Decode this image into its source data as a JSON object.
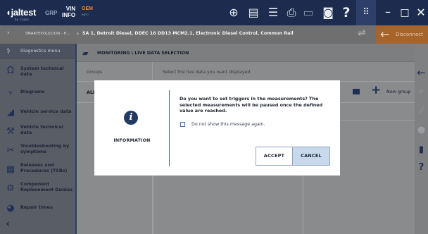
{
  "topbar": {
    "logo": "jaltest",
    "logo_sub": "by Cojali",
    "grp": "GRP",
    "vin_line1": "VIN",
    "vin_line2": "INFO",
    "oem_line1": "OEM",
    "oem_line2": "INFO",
    "icons": [
      "globe-icon",
      "document-icon",
      "list-icon",
      "print-icon",
      "battery-icon",
      "camera-icon",
      "help-icon",
      "grid-icon",
      "minimize-icon",
      "maximize-icon",
      "close-icon"
    ],
    "glyphs": {
      "globe": "⊕",
      "doc": "▤",
      "list": "☰",
      "print": "⎙",
      "battery": "▭",
      "camera": "◙",
      "help": "?",
      "grid": "⠿",
      "min": "–",
      "max": "□",
      "close": "✕"
    }
  },
  "breadcrumb": {
    "chevron": "›",
    "item1": "SMARTEVOLUCION - H...",
    "separator": "›",
    "item2": "SA 1, Detroit Diesel, DDEC 16 DD13 MCM2.1, Electronic Diesel Control, Common Rail",
    "disconnect_label": "Disconnect",
    "disconnect_arrow": "←",
    "plug_glyph": "⇌"
  },
  "sidebar": {
    "header_label": "Diagnostics menu",
    "header_icon": "stethoscope-icon",
    "items": [
      {
        "label": "System technical data",
        "icon": "omega-icon",
        "glyph": "Ω"
      },
      {
        "label": "Diagrams",
        "icon": "diagram-icon",
        "glyph": "⫟"
      },
      {
        "label": "Vehicle service data",
        "icon": "oil-can-icon",
        "glyph": "◢"
      },
      {
        "label": "Vehicle technical data",
        "icon": "wrench-icon",
        "glyph": "⚒"
      },
      {
        "label": "Troubleshooting by symptoms",
        "icon": "tools-icon",
        "glyph": "✂"
      },
      {
        "label": "Releases and Procedures (TSBs)",
        "icon": "book-icon",
        "glyph": "▦"
      },
      {
        "label": "Component Replacement Guides",
        "icon": "replace-icon",
        "glyph": "⚙"
      },
      {
        "label": "Repair times",
        "icon": "gear-clock-icon",
        "glyph": "◕"
      }
    ],
    "back_glyph": "‹"
  },
  "main": {
    "header_title": "MONITORING \\ LIVE DATA SELECTION",
    "groups_label": "Groups",
    "select_label": "Select the live data you want displayed",
    "all_label": "ALL",
    "new_group_label": "New group",
    "plus_glyph": "+"
  },
  "right_toolbar": {
    "icons": [
      "back-arrow-icon",
      "search-icon",
      "chart-icon",
      "record-icon",
      "save-icon",
      "help-icon"
    ],
    "glyphs": [
      "←",
      "⌕",
      "⟋",
      "●",
      "▮",
      "?"
    ]
  },
  "modal": {
    "title": "INFORMATION",
    "info_glyph": "i",
    "message": "Do you want to set triggers in the measurements? The selected measurements will be paused once the defined value are reached.",
    "checkbox_label": "Do not show this message again.",
    "checkbox_checked": false,
    "accept_label": "ACCEPT",
    "cancel_label": "CANCEL"
  },
  "colors": {
    "topbar": "#1d2c4e",
    "accent_orange": "#a6642d",
    "info_icon": "#233a63",
    "cancel_button": "#c7d9ea"
  }
}
